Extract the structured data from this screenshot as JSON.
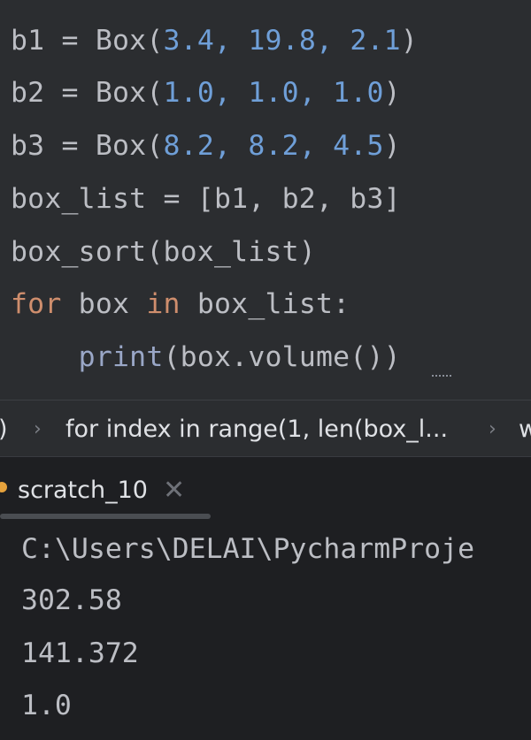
{
  "editor": {
    "lines": [
      {
        "seg": [
          "b1 = Box(",
          "3.4",
          ", ",
          "19.8",
          ", ",
          "2.1",
          ")"
        ]
      },
      {
        "seg": [
          "b2 = Box(",
          "1.0",
          ", ",
          "1.0",
          ", ",
          "1.0",
          ")"
        ]
      },
      {
        "seg": [
          "b3 = Box(",
          "8.2",
          ", ",
          "8.2",
          ", ",
          "4.5",
          ")"
        ]
      },
      {
        "text": "box_list = [b1, b2, b3]"
      },
      {
        "text": "box_sort(box_list)"
      },
      {
        "kw1": "for",
        "mid1": " box ",
        "kw2": "in",
        "rest": " box_list:"
      },
      {
        "indent": "    ",
        "fn": "print",
        "rest": "(box.volume())"
      }
    ]
  },
  "breadcrumb": {
    "left_fragment": ")",
    "sep": "›",
    "item": "for index in range(1, len(box_l...",
    "right_fragment": "w"
  },
  "run_panel": {
    "tab_label": "scratch_10",
    "tab_close": "✕",
    "output": [
      "C:\\Users\\DELAI\\PycharmProje",
      "302.58",
      "141.372",
      "1.0"
    ]
  },
  "colors": {
    "editor_bg": "#2b2d30",
    "console_bg": "#1e1f22",
    "text": "#bcbec4",
    "number": "#6f9fd8",
    "keyword": "#cf8e6d",
    "builtin": "#9aa7c7",
    "tab_dot": "#e6a23c"
  }
}
